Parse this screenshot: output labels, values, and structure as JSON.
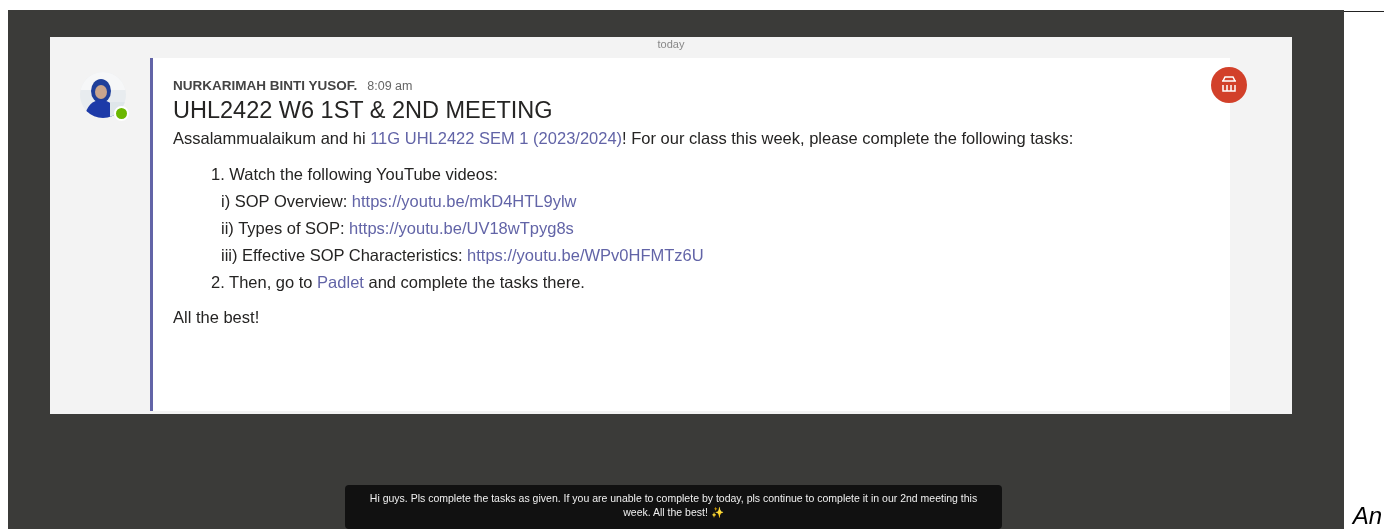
{
  "separator": {
    "label": "today"
  },
  "message": {
    "author": "NURKARIMAH BINTI YUSOF.",
    "time": "8:09 am",
    "online": true,
    "subject": "UHL2422 W6 1ST & 2ND MEETING",
    "body": [
      {
        "kind": "paragraph",
        "parts": [
          {
            "kind": "text",
            "text": "Assalammualaikum and hi "
          },
          {
            "kind": "mention",
            "text": "11G UHL2422 SEM 1 (2023/2024)"
          },
          {
            "kind": "text",
            "text": "! For our class this week, please complete the following tasks:"
          }
        ]
      },
      {
        "kind": "list",
        "items": [
          {
            "marker": "1.",
            "parts": [
              {
                "kind": "text",
                "text": "Watch the following YouTube videos:"
              }
            ],
            "children": [
              {
                "marker": "i)",
                "parts": [
                  {
                    "kind": "text",
                    "text": "SOP Overview: "
                  },
                  {
                    "kind": "link",
                    "text": "https://youtu.be/mkD4HTL9ylw"
                  }
                ]
              },
              {
                "marker": "ii)",
                "parts": [
                  {
                    "kind": "text",
                    "text": "Types of SOP: "
                  },
                  {
                    "kind": "link",
                    "text": "https://youtu.be/UV18wTpyg8s"
                  }
                ]
              },
              {
                "marker": "iii)",
                "parts": [
                  {
                    "kind": "text",
                    "text": "Effective SOP Characteristics: "
                  },
                  {
                    "kind": "link",
                    "text": "https://youtu.be/WPv0HFMTz6U"
                  }
                ]
              }
            ]
          },
          {
            "marker": "2.",
            "parts": [
              {
                "kind": "text",
                "text": "Then, go to "
              },
              {
                "kind": "link",
                "text": "Padlet"
              },
              {
                "kind": "text",
                "text": " and complete the tasks there."
              }
            ]
          }
        ]
      },
      {
        "kind": "paragraph",
        "parts": [
          {
            "kind": "text",
            "text": "All the best!"
          }
        ]
      }
    ]
  },
  "caption": {
    "text": "Hi guys. Pls complete the tasks as given. If you are unable to complete by today, pls continue to complete it in our 2nd meeting this week. All the best! ✨"
  },
  "corner_text": "An"
}
